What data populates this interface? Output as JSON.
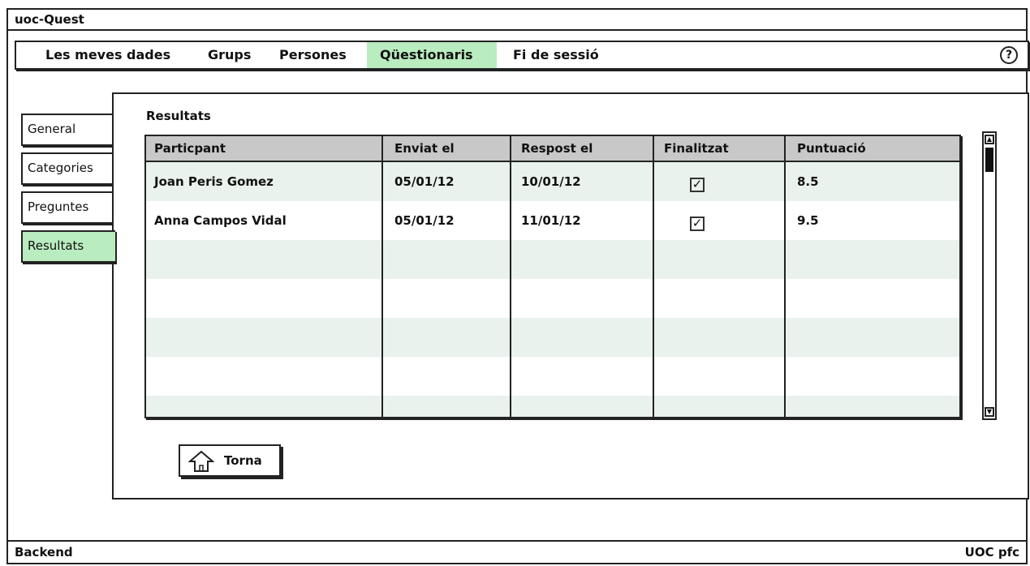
{
  "window": {
    "title": "uoc-Quest"
  },
  "menu": {
    "items": [
      "Les meves dades",
      "Grups",
      "Persones",
      "Qüestionaris",
      "Fi de sessió"
    ],
    "active": "Qüestionaris",
    "help_label": "?"
  },
  "sidebar": {
    "tabs": [
      "General",
      "Categories",
      "Preguntes",
      "Resultats"
    ],
    "active": "Resultats"
  },
  "panel": {
    "title": "Resultats",
    "table": {
      "columns": [
        "Particpant",
        "Enviat el",
        "Respost el",
        "Finalitzat",
        "Puntuació"
      ],
      "rows": [
        {
          "participant": "Joan Peris Gomez",
          "sent": "05/01/12",
          "answered": "10/01/12",
          "finished": true,
          "score": "8.5"
        },
        {
          "participant": "Anna Campos Vidal",
          "sent": "05/01/12",
          "answered": "11/01/12",
          "finished": true,
          "score": "9.5"
        }
      ]
    },
    "back_button": {
      "label": "Torna",
      "icon": "home-icon"
    }
  },
  "footer": {
    "left": "Backend",
    "right": "UOC pfc"
  },
  "colors": {
    "active": "#b9ecbf",
    "header": "#c8c8c8",
    "row_alt": "#e9f2ec"
  }
}
